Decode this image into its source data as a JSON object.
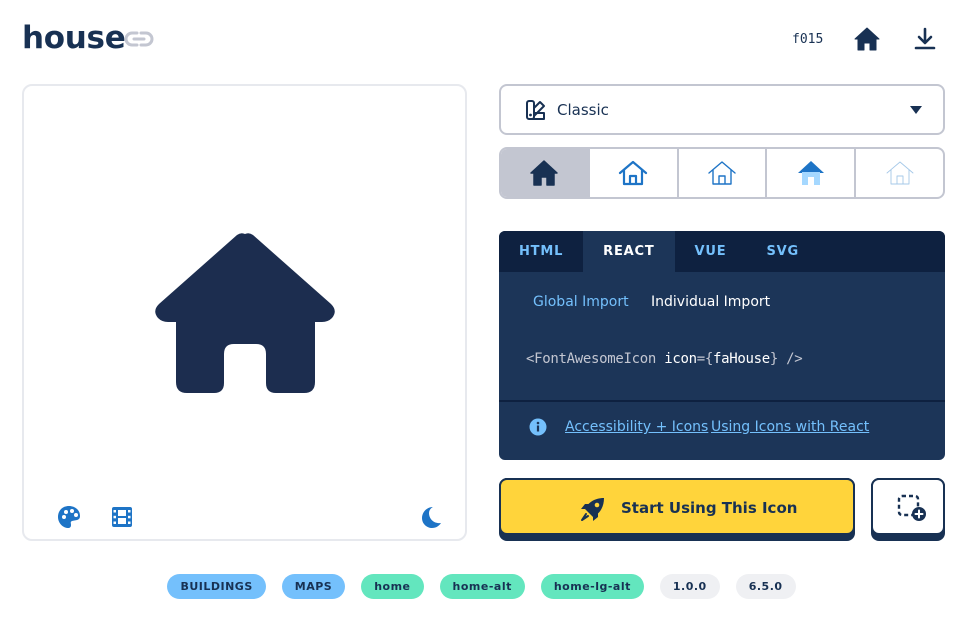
{
  "header": {
    "title": "house",
    "unicode": "f015",
    "icons": [
      "link-icon",
      "house-icon",
      "download-icon"
    ]
  },
  "preview": {
    "icon": "house-icon",
    "tools": [
      "palette-icon",
      "film-icon",
      "moon-icon"
    ]
  },
  "style_select": {
    "icon": "swatchbook-icon",
    "value": "Classic"
  },
  "families": [
    {
      "name": "solid",
      "icon": "house-solid-icon",
      "active": true
    },
    {
      "name": "regular",
      "icon": "house-regular-icon",
      "active": false
    },
    {
      "name": "light",
      "icon": "house-light-icon",
      "active": false
    },
    {
      "name": "duotone",
      "icon": "house-duotone-icon",
      "active": false
    },
    {
      "name": "thin",
      "icon": "house-thin-icon",
      "active": false
    }
  ],
  "code_panel": {
    "tabs": [
      "HTML",
      "REACT",
      "VUE",
      "SVG"
    ],
    "active_tab": "REACT",
    "sub_tabs": [
      "Global Import",
      "Individual Import"
    ],
    "active_sub_tab": "Individual Import",
    "code": {
      "open": "<FontAwesomeIcon ",
      "attr": "icon",
      "eq": "=",
      "brace_open": "{",
      "value": "faHouse",
      "brace_close": "}",
      "close": " />"
    },
    "links": [
      "Accessibility + Icons",
      "Using Icons with React"
    ]
  },
  "cta": {
    "label": "Start Using This Icon",
    "icon": "rocket-icon"
  },
  "kit_button": {
    "icon": "square-dashed-plus-icon"
  },
  "tags": {
    "categories": [
      "BUILDINGS",
      "MAPS"
    ],
    "aliases": [
      "home",
      "home-alt",
      "home-lg-alt"
    ],
    "versions": [
      "1.0.0",
      "6.5.0"
    ]
  },
  "colors": {
    "navy": "#183153",
    "panel": "#1c3558",
    "panel_dark": "#0e2140",
    "yellow": "#ffd43b",
    "blue": "#74c0fc",
    "teal": "#63e6be",
    "gray": "#c3c6d1",
    "icon_blue": "#1e74c6"
  }
}
